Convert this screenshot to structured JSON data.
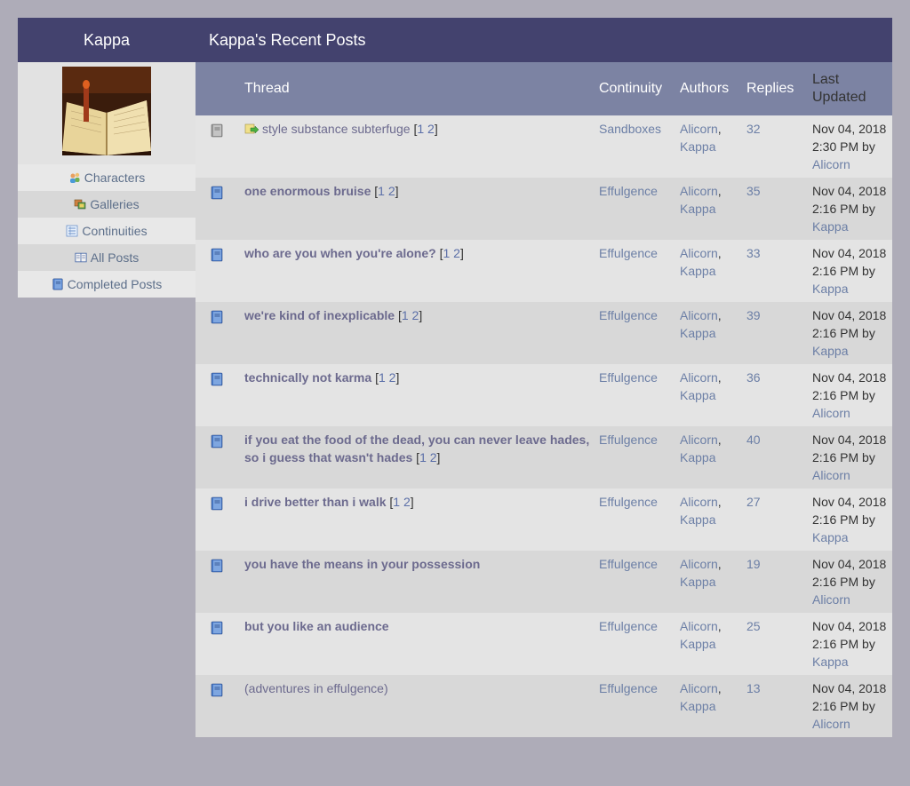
{
  "sidebar": {
    "title": "Kappa",
    "items": [
      {
        "label": "Characters",
        "icon": "characters-icon"
      },
      {
        "label": "Galleries",
        "icon": "galleries-icon"
      },
      {
        "label": "Continuities",
        "icon": "continuities-icon"
      },
      {
        "label": "All Posts",
        "icon": "open-book-icon"
      },
      {
        "label": "Completed Posts",
        "icon": "book-icon"
      }
    ]
  },
  "main": {
    "title": "Kappa's Recent Posts",
    "columns": {
      "thread": "Thread",
      "continuity": "Continuity",
      "authors": "Authors",
      "replies": "Replies",
      "last_updated_1": "Last",
      "last_updated_2": "Updated"
    },
    "posts": [
      {
        "title": "style substance subterfuge",
        "bold": false,
        "sandbox": true,
        "pages": [
          "1",
          "2"
        ],
        "continuity": "Sandboxes",
        "author1": "Alicorn",
        "author2": "Kappa",
        "replies": "32",
        "date": "Nov 04, 2018",
        "time": "2:30 PM by",
        "by": "Alicorn"
      },
      {
        "title": "one enormous bruise",
        "bold": true,
        "sandbox": false,
        "pages": [
          "1",
          "2"
        ],
        "continuity": "Effulgence",
        "author1": "Alicorn",
        "author2": "Kappa",
        "replies": "35",
        "date": "Nov 04, 2018",
        "time": "2:16 PM by",
        "by": "Kappa"
      },
      {
        "title": "who are you when you're alone?",
        "bold": true,
        "sandbox": false,
        "pages": [
          "1",
          "2"
        ],
        "continuity": "Effulgence",
        "author1": "Alicorn",
        "author2": "Kappa",
        "replies": "33",
        "date": "Nov 04, 2018",
        "time": "2:16 PM by",
        "by": "Kappa"
      },
      {
        "title": "we're kind of inexplicable",
        "bold": true,
        "sandbox": false,
        "pages": [
          "1",
          "2"
        ],
        "continuity": "Effulgence",
        "author1": "Alicorn",
        "author2": "Kappa",
        "replies": "39",
        "date": "Nov 04, 2018",
        "time": "2:16 PM by",
        "by": "Kappa"
      },
      {
        "title": "technically not karma",
        "bold": true,
        "sandbox": false,
        "pages": [
          "1",
          "2"
        ],
        "continuity": "Effulgence",
        "author1": "Alicorn",
        "author2": "Kappa",
        "replies": "36",
        "date": "Nov 04, 2018",
        "time": "2:16 PM by",
        "by": "Alicorn"
      },
      {
        "title": "if you eat the food of the dead, you can never leave hades, so i guess that wasn't hades",
        "bold": true,
        "sandbox": false,
        "pages": [
          "1",
          "2"
        ],
        "continuity": "Effulgence",
        "author1": "Alicorn",
        "author2": "Kappa",
        "replies": "40",
        "date": "Nov 04, 2018",
        "time": "2:16 PM by",
        "by": "Alicorn"
      },
      {
        "title": "i drive better than i walk",
        "bold": true,
        "sandbox": false,
        "pages": [
          "1",
          "2"
        ],
        "continuity": "Effulgence",
        "author1": "Alicorn",
        "author2": "Kappa",
        "replies": "27",
        "date": "Nov 04, 2018",
        "time": "2:16 PM by",
        "by": "Kappa"
      },
      {
        "title": "you have the means in your possession",
        "bold": true,
        "sandbox": false,
        "pages": [],
        "continuity": "Effulgence",
        "author1": "Alicorn",
        "author2": "Kappa",
        "replies": "19",
        "date": "Nov 04, 2018",
        "time": "2:16 PM by",
        "by": "Alicorn"
      },
      {
        "title": "but you like an audience",
        "bold": true,
        "sandbox": false,
        "pages": [],
        "continuity": "Effulgence",
        "author1": "Alicorn",
        "author2": "Kappa",
        "replies": "25",
        "date": "Nov 04, 2018",
        "time": "2:16 PM by",
        "by": "Kappa"
      },
      {
        "title": "(adventures in effulgence)",
        "bold": false,
        "sandbox": false,
        "pages": [],
        "continuity": "Effulgence",
        "author1": "Alicorn",
        "author2": "Kappa",
        "replies": "13",
        "date": "Nov 04, 2018",
        "time": "2:16 PM by",
        "by": "Alicorn"
      }
    ]
  },
  "colors": {
    "header": "#43426e",
    "table_header": "#7c83a3",
    "link": "#6c6a8e",
    "page": "#aeacb8"
  }
}
